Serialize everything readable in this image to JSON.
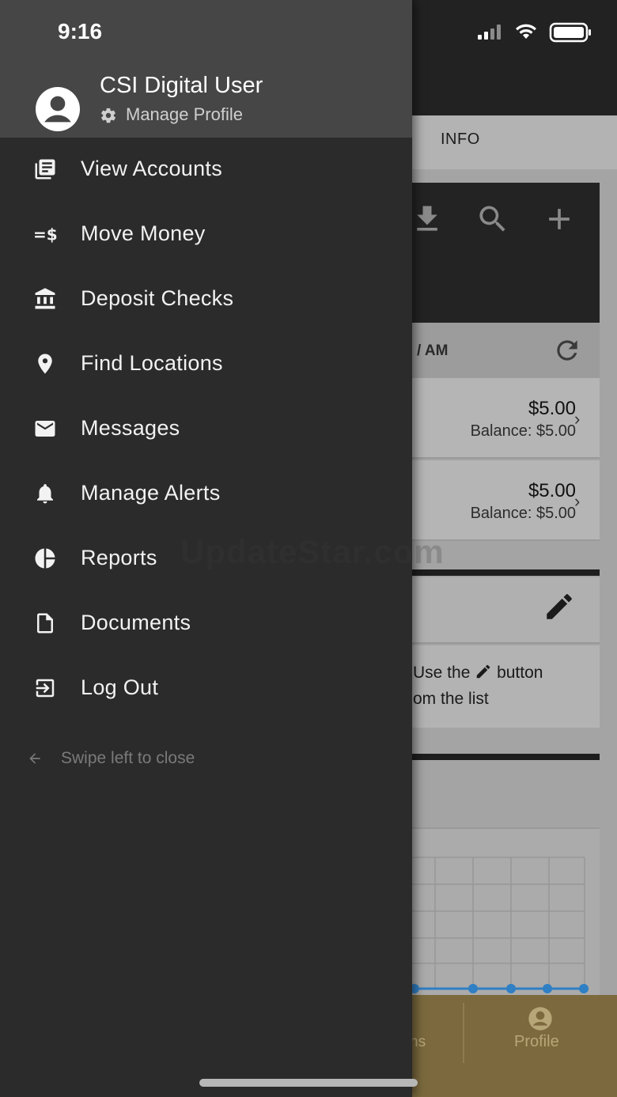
{
  "status_bar": {
    "time": "9:16"
  },
  "drawer": {
    "user_name": "CSI Digital User",
    "manage_profile": "Manage Profile",
    "menu": [
      {
        "label": "View Accounts",
        "icon": "accounts-list-icon"
      },
      {
        "label": "Move Money",
        "icon": "transfer-dollar-icon"
      },
      {
        "label": "Deposit Checks",
        "icon": "bank-icon"
      },
      {
        "label": "Find Locations",
        "icon": "location-pin-icon"
      },
      {
        "label": "Messages",
        "icon": "envelope-icon"
      },
      {
        "label": "Manage Alerts",
        "icon": "bell-icon"
      },
      {
        "label": "Reports",
        "icon": "pie-chart-icon"
      },
      {
        "label": "Documents",
        "icon": "document-icon"
      },
      {
        "label": "Log Out",
        "icon": "logout-icon"
      }
    ],
    "swipe_hint": "Swipe left to close"
  },
  "background": {
    "tab_info": "INFO",
    "timestamp_partial": "/ AM",
    "accounts": [
      {
        "amount": "$5.00",
        "balance": "Balance: $5.00"
      },
      {
        "amount": "$5.00",
        "balance": "Balance: $5.00"
      }
    ],
    "hint_line_1_a": "Use the",
    "hint_line_1_b": "button",
    "hint_line_2": "om the list",
    "bottom_tab_partial": "ns",
    "bottom_tab_profile": "Profile"
  },
  "watermark": "UpdateStar.com",
  "colors": {
    "drawer_bg": "#2b2b2b",
    "drawer_header_bg": "#464646",
    "bottom_bar": "#7c6a3e",
    "chart_line": "#2f7fc4"
  }
}
